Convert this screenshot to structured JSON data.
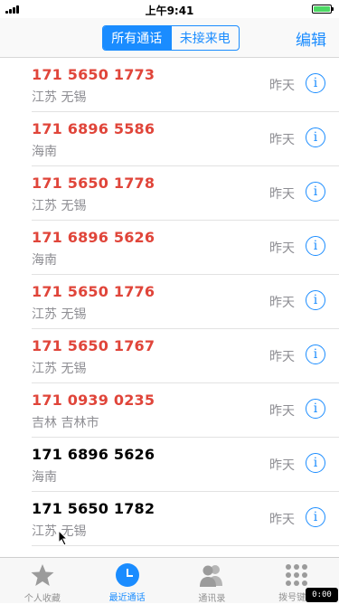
{
  "status": {
    "time": "上午9:41"
  },
  "nav": {
    "segments": [
      "所有通话",
      "未接来电"
    ],
    "active_segment": 0,
    "edit_label": "编辑"
  },
  "calls": [
    {
      "number": "171 5650 1773",
      "location": "江苏 无锡",
      "time": "昨天",
      "missed": true
    },
    {
      "number": "171 6896 5586",
      "location": "海南",
      "time": "昨天",
      "missed": true
    },
    {
      "number": "171 5650 1778",
      "location": "江苏 无锡",
      "time": "昨天",
      "missed": true
    },
    {
      "number": "171 6896 5626",
      "location": "海南",
      "time": "昨天",
      "missed": true
    },
    {
      "number": "171 5650 1776",
      "location": "江苏 无锡",
      "time": "昨天",
      "missed": true
    },
    {
      "number": "171 5650 1767",
      "location": "江苏 无锡",
      "time": "昨天",
      "missed": true
    },
    {
      "number": "171 0939 0235",
      "location": "吉林 吉林市",
      "time": "昨天",
      "missed": true
    },
    {
      "number": "171 6896 5626",
      "location": "海南",
      "time": "昨天",
      "missed": false
    },
    {
      "number": "171 5650 1782",
      "location": "江苏 无锡",
      "time": "昨天",
      "missed": false
    }
  ],
  "tabs": [
    {
      "label": "个人收藏",
      "icon": "star-icon",
      "active": false
    },
    {
      "label": "最近通话",
      "icon": "clock-icon",
      "active": true
    },
    {
      "label": "通讯录",
      "icon": "contacts-icon",
      "active": false
    },
    {
      "label": "拨号键盘",
      "icon": "keypad-icon",
      "active": false
    }
  ],
  "video_badge": "0:00",
  "colors": {
    "accent": "#1a8cff",
    "missed": "#e0453a",
    "secondary": "#8e8e93"
  }
}
